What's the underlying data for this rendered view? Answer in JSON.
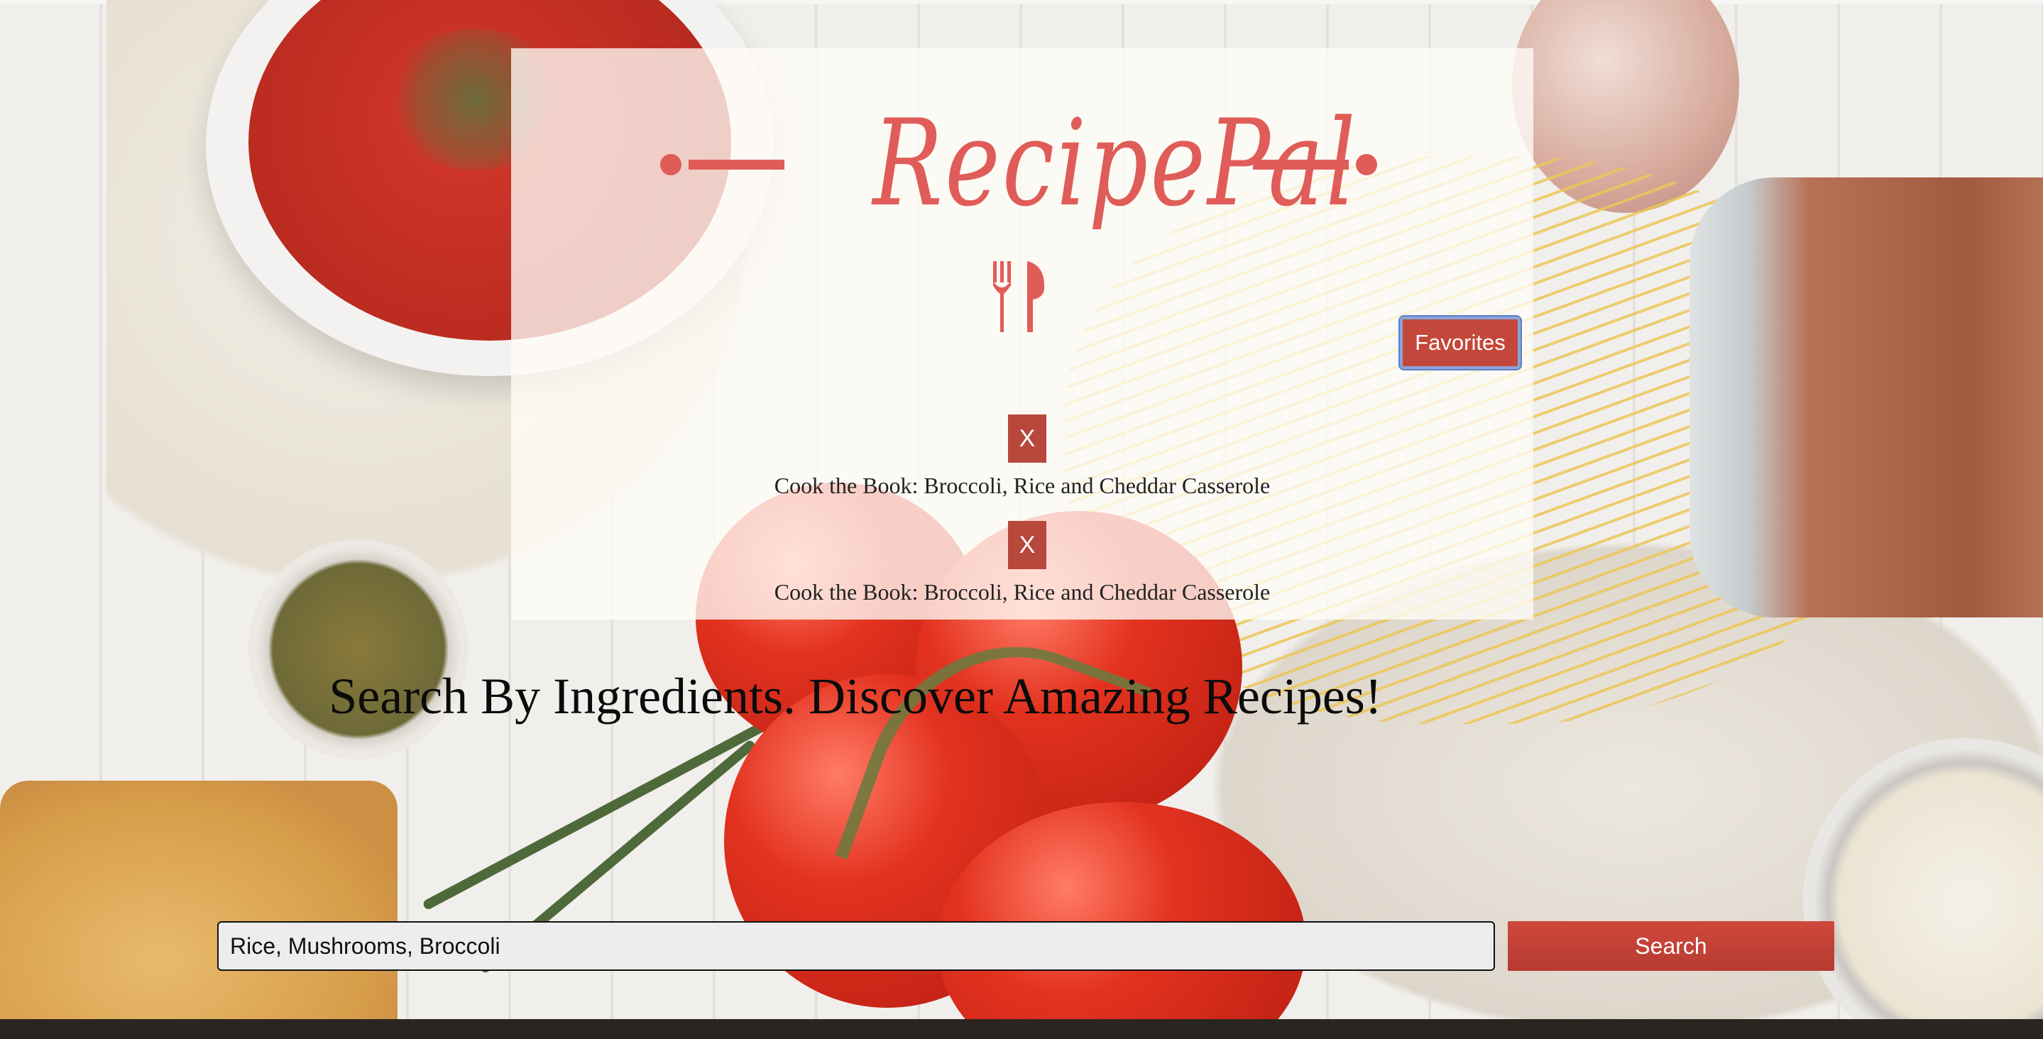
{
  "app": {
    "logo_text": "RecipePal",
    "brand_color": "#e05c58",
    "utensils_icon": "fork-knife-icon"
  },
  "header": {
    "favorites_label": "Favorites",
    "favorites_color": "#c4473b"
  },
  "favorites": [
    {
      "remove_label": "X",
      "title": "Cook the Book: Broccoli, Rice and Cheddar Casserole"
    },
    {
      "remove_label": "X",
      "title": "Cook the Book: Broccoli, Rice and Cheddar Casserole"
    }
  ],
  "tagline": "Search By Ingredients. Discover Amazing Recipes!",
  "search": {
    "value": "Rice, Mushrooms, Broccoli",
    "button_label": "Search",
    "button_color": "#c4473b"
  }
}
